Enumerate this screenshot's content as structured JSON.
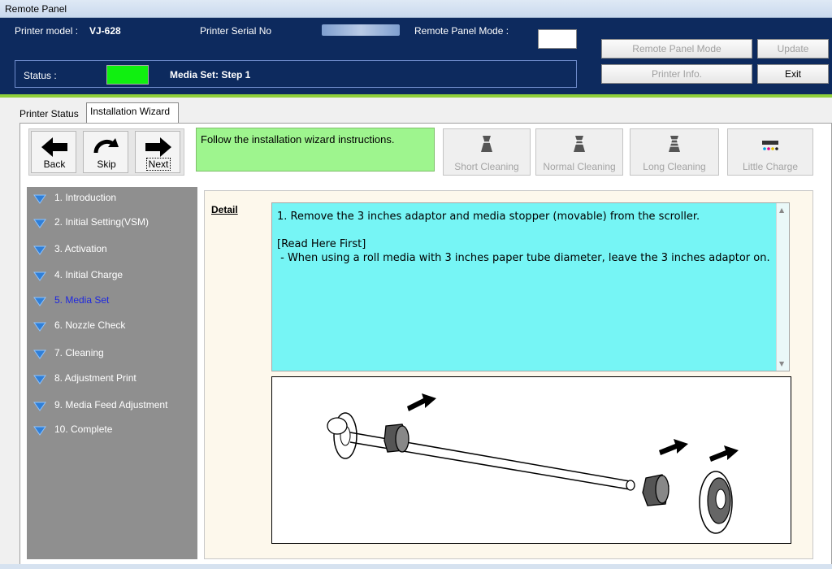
{
  "window": {
    "title": "Remote Panel"
  },
  "header": {
    "printer_model_label": "Printer model :",
    "printer_model_value": "VJ-628",
    "serial_label": "Printer Serial No",
    "remote_mode_label": "Remote Panel Mode :",
    "status_label": "Status :",
    "status_color": "#10f010",
    "status_text": "Media Set: Step 1",
    "buttons": {
      "remote_panel_mode": "Remote Panel Mode",
      "update": "Update",
      "printer_info": "Printer Info.",
      "exit": "Exit"
    }
  },
  "tabs": {
    "printer_status": "Printer Status",
    "installation_wizard": "Installation Wizard"
  },
  "toolbar": {
    "back": "Back",
    "skip": "Skip",
    "next": "Next",
    "instruction": "Follow the installation wizard instructions.",
    "short_cleaning": "Short Cleaning",
    "normal_cleaning": "Normal Cleaning",
    "long_cleaning": "Long Cleaning",
    "little_charge": "Little Charge"
  },
  "steps": [
    {
      "label": "1. Introduction"
    },
    {
      "label": "2. Initial Setting(VSM)"
    },
    {
      "label": "3. Activation"
    },
    {
      "label": "4. Initial Charge"
    },
    {
      "label": "5. Media Set",
      "current": true
    },
    {
      "label": "6. Nozzle Check"
    },
    {
      "label": "7. Cleaning"
    },
    {
      "label": "8. Adjustment Print"
    },
    {
      "label": "9. Media Feed Adjustment"
    },
    {
      "label": "10. Complete"
    }
  ],
  "detail": {
    "label": "Detail",
    "line1": "1. Remove the 3 inches adaptor and media stopper (movable) from the scroller.",
    "line2": "[Read Here First]",
    "line3": " - When using a roll media with 3 inches paper tube diameter, leave the 3 inches adaptor on."
  }
}
